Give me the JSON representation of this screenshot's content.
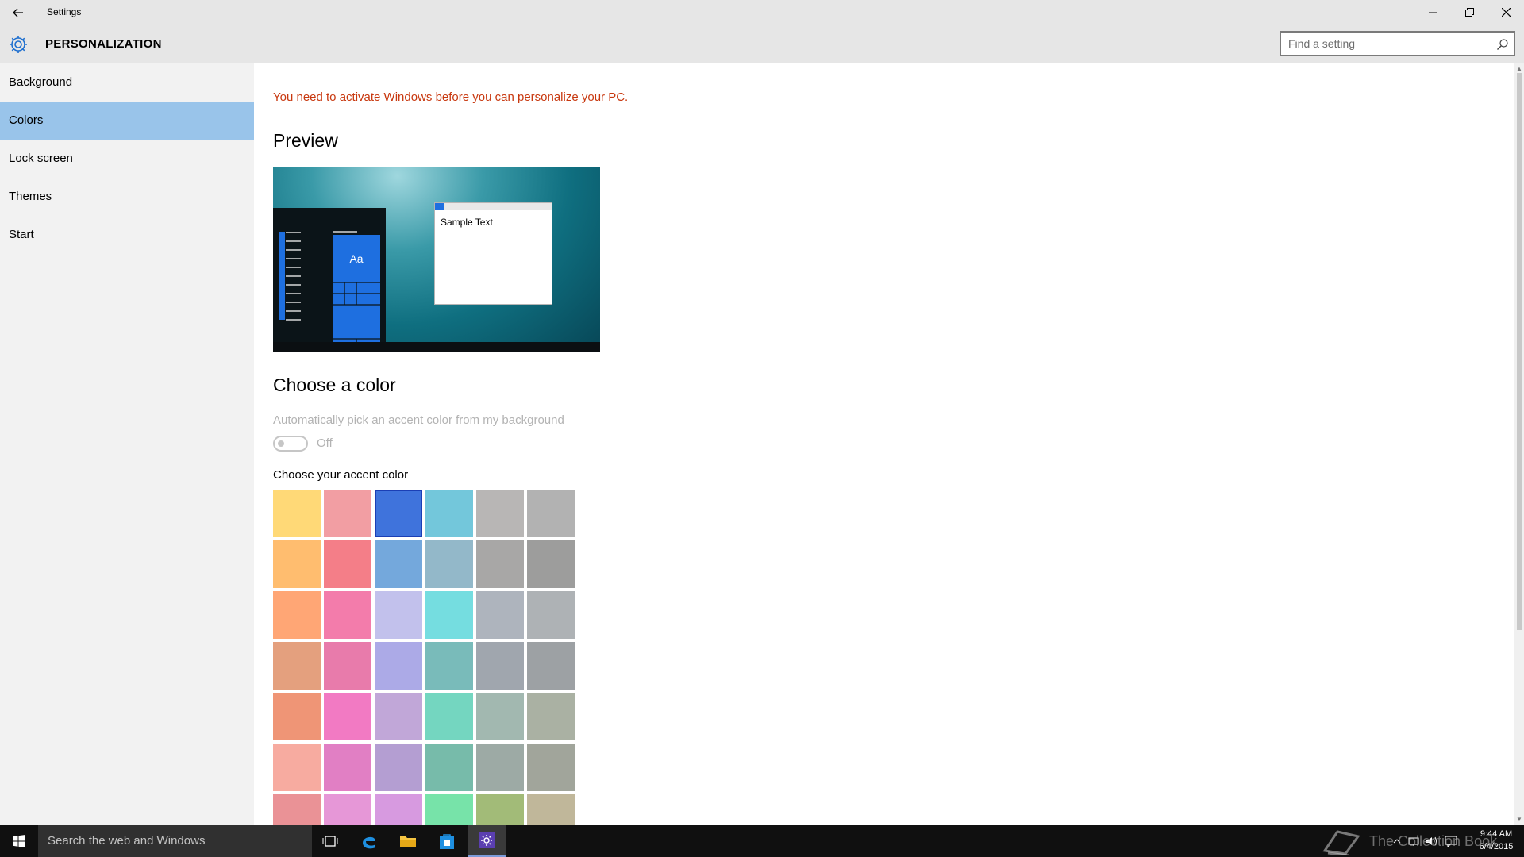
{
  "window": {
    "title": "Settings"
  },
  "header": {
    "title": "PERSONALIZATION",
    "search_placeholder": "Find a setting"
  },
  "sidebar": {
    "items": [
      {
        "label": "Background",
        "active": false
      },
      {
        "label": "Colors",
        "active": true
      },
      {
        "label": "Lock screen",
        "active": false
      },
      {
        "label": "Themes",
        "active": false
      },
      {
        "label": "Start",
        "active": false
      }
    ]
  },
  "main": {
    "activation_message": "You need to activate Windows before you can personalize your PC.",
    "preview_title": "Preview",
    "preview": {
      "sample_text": "Sample Text",
      "tile_text": "Aa"
    },
    "choose_color_title": "Choose a color",
    "auto_pick_label": "Automatically pick an accent color from my background",
    "auto_pick_state": "Off",
    "accent_label": "Choose your accent color",
    "accent_colors": [
      [
        "#ffd977",
        "#f29ea3",
        "#3f73dc",
        "#73c7db",
        "#b8b6b5",
        "#b2b2b2"
      ],
      [
        "#ffbd6f",
        "#f47e88",
        "#74a8dc",
        "#93b8c9",
        "#a8a7a6",
        "#9d9d9c"
      ],
      [
        "#ffa675",
        "#f37cab",
        "#c2c1ec",
        "#75dde0",
        "#aeb4bd",
        "#aeb2b5"
      ],
      [
        "#e4a07e",
        "#e87bab",
        "#acaae7",
        "#79bbba",
        "#a0a6ae",
        "#9da1a4"
      ],
      [
        "#ef9576",
        "#f27ac3",
        "#c1a7d8",
        "#74d6c0",
        "#a2b8b0",
        "#aab1a3"
      ],
      [
        "#f7aba0",
        "#e17fc4",
        "#b49ed2",
        "#77bbaa",
        "#9daaa5",
        "#a1a59b"
      ],
      [
        "#ea9296",
        "#e697d7",
        "#d79ae0",
        "#77e3a9",
        "#a2bb78",
        "#c0b79a"
      ]
    ],
    "selected_color": "#3f73dc"
  },
  "taskbar": {
    "search_placeholder": "Search the web and Windows",
    "time": "9:44 AM",
    "date": "6/4/2015",
    "watermark": "The Collection Book"
  }
}
